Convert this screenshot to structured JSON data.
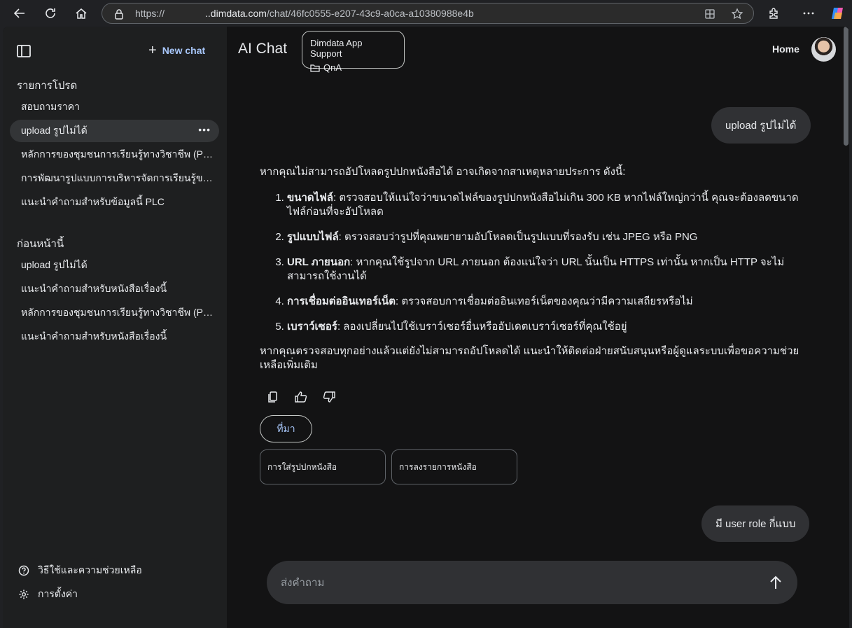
{
  "browser": {
    "url_prefix": "https://",
    "url_host": "..dimdata.com",
    "url_path": "/chat/46fc0555-e207-43c9-a0ca-a10380988e4b"
  },
  "sidebar": {
    "new_chat_label": "New chat",
    "favorites_heading": "รายการโปรด",
    "favorites": [
      {
        "label": "สอบถามราคา"
      },
      {
        "label": "upload รูปไม่ได้",
        "more": "•••"
      },
      {
        "label": "หลักการของชุมชนการเรียนรู้ทางวิชาชีพ (PLC)"
      },
      {
        "label": "การพัฒนารูปแบบการบริหารจัดการเรียนรู้ของ..."
      },
      {
        "label": "แนะนำคำถามสำหรับข้อมูลนี้ PLC"
      }
    ],
    "recent_heading": "ก่อนหน้านี้",
    "recent": [
      {
        "label": "upload รูปไม่ได้"
      },
      {
        "label": "แนะนำคำถามสำหรับหนังสือเรื่องนี้"
      },
      {
        "label": "หลักการของชุมชนการเรียนรู้ทางวิชาชีพ (PLC)"
      },
      {
        "label": "แนะนำคำถามสำหรับหนังสือเรื่องนี้"
      }
    ],
    "help_label": "วิธีใช้และความช่วยเหลือ",
    "settings_label": "การตั้งค่า"
  },
  "header": {
    "title": "AI Chat",
    "context_title": "Dimdata App Support",
    "context_sub": "QnA",
    "home_label": "Home"
  },
  "chat": {
    "user_message_1": "upload รูปไม่ได้",
    "answer_intro": "หากคุณไม่สามารถอัปโหลดรูปปกหนังสือได้ อาจเกิดจากสาเหตุหลายประการ ดังนี้:",
    "answer_items": [
      {
        "title": "ขนาดไฟล์",
        "text": ": ตรวจสอบให้แน่ใจว่าขนาดไฟล์ของรูปปกหนังสือไม่เกิน 300 KB หากไฟล์ใหญ่กว่านี้ คุณจะต้องลดขนาดไฟล์ก่อนที่จะอัปโหลด"
      },
      {
        "title": "รูปแบบไฟล์",
        "text": ": ตรวจสอบว่ารูปที่คุณพยายามอัปโหลดเป็นรูปแบบที่รองรับ เช่น JPEG หรือ PNG"
      },
      {
        "title": "URL ภายนอก",
        "text": ": หากคุณใช้รูปจาก URL ภายนอก ต้องแน่ใจว่า URL นั้นเป็น HTTPS เท่านั้น หากเป็น HTTP จะไม่สามารถใช้งานได้"
      },
      {
        "title": "การเชื่อมต่ออินเทอร์เน็ต",
        "text": ": ตรวจสอบการเชื่อมต่ออินเทอร์เน็ตของคุณว่ามีความเสถียรหรือไม่"
      },
      {
        "title": "เบราว์เซอร์",
        "text": ": ลองเปลี่ยนไปใช้เบราว์เซอร์อื่นหรืออัปเดตเบราว์เซอร์ที่คุณใช้อยู่"
      }
    ],
    "answer_outro": "หากคุณตรวจสอบทุกอย่างแล้วแต่ยังไม่สามารถอัปโหลดได้ แนะนำให้ติดต่อฝ่ายสนับสนุนหรือผู้ดูแลระบบเพื่อขอความช่วยเหลือเพิ่มเติม",
    "source_label": "ที่มา",
    "references": [
      "การใส่รูปปกหนังสือ",
      "การลงรายการหนังสือ"
    ],
    "user_message_2": "มี user role กี่แบบ",
    "input_placeholder": "ส่งคำถาม"
  }
}
